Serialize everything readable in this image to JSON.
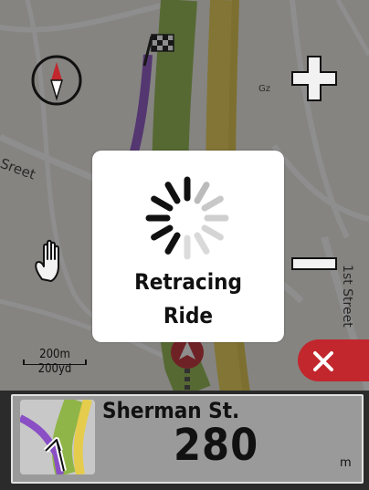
{
  "map": {
    "street_labels": [
      "Sreet",
      "1st Street"
    ],
    "scale": {
      "top": "200m",
      "bottom": "200yd"
    }
  },
  "dialog": {
    "line1": "Retracing",
    "line2": "Ride",
    "icon": "spinner-icon"
  },
  "controls": {
    "compass_icon": "compass-icon",
    "zoom_in_icon": "plus-icon",
    "zoom_out_icon": "minus-icon",
    "pan_icon": "hand-icon",
    "close_icon": "close-icon"
  },
  "turn": {
    "street": "Sherman St.",
    "distance": "280",
    "unit": "m"
  },
  "colors": {
    "route": "#8a4fc4",
    "road_green": "#8fb548",
    "road_yellow": "#e6cc4c",
    "close_button": "#c1272d"
  }
}
